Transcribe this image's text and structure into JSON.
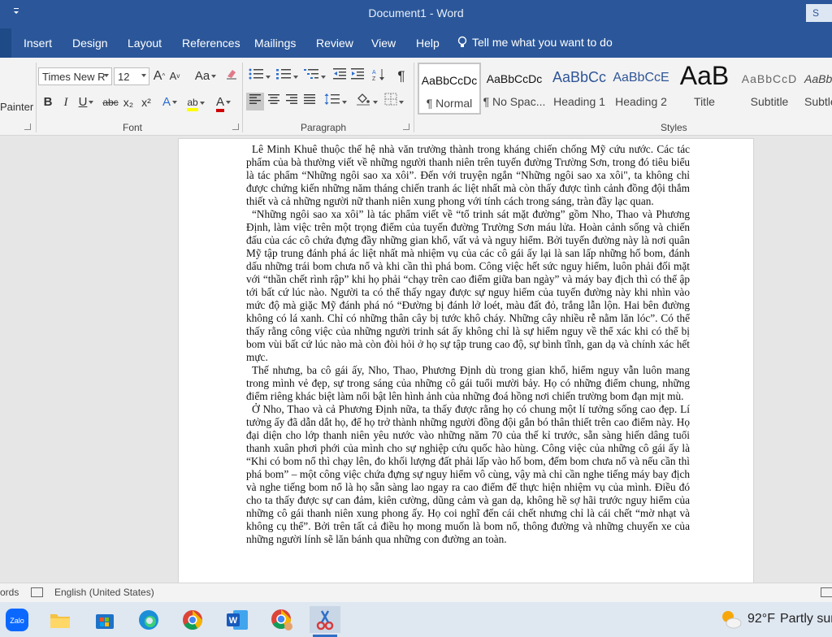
{
  "window": {
    "title": "Document1  -  Word",
    "signin_label": "S"
  },
  "tabs": [
    {
      "label": "Insert"
    },
    {
      "label": "Design"
    },
    {
      "label": "Layout"
    },
    {
      "label": "References"
    },
    {
      "label": "Mailings"
    },
    {
      "label": "Review"
    },
    {
      "label": "View"
    },
    {
      "label": "Help"
    }
  ],
  "tell_me": {
    "label": "Tell me what you want to do",
    "icon": "lightbulb-icon"
  },
  "clipboard": {
    "format_painter_label": "Painter"
  },
  "font": {
    "group_label": "Font",
    "name": "Times New R",
    "size": "12",
    "grow_label": "A",
    "shrink_label": "A",
    "change_case_label": "Aa",
    "bold": "B",
    "italic": "I",
    "underline": "U",
    "strike": "abc",
    "subscript": "x₂",
    "superscript": "x²",
    "effects": "A",
    "highlight": "ab",
    "color": "A",
    "highlight_color": "#ffff00",
    "font_color": "#d00000"
  },
  "paragraph": {
    "group_label": "Paragraph",
    "pilcrow": "¶"
  },
  "styles": {
    "group_label": "Styles",
    "items": [
      {
        "sample": "AaBbCcDc",
        "name": "¶ Normal"
      },
      {
        "sample": "AaBbCcDc",
        "name": "¶ No Spac..."
      },
      {
        "sample": "AaBbCc",
        "name": "Heading 1"
      },
      {
        "sample": "AaBbCcE",
        "name": "Heading 2"
      },
      {
        "sample": "AaB",
        "name": "Title"
      },
      {
        "sample": "AaBbCcD",
        "name": "Subtitle"
      },
      {
        "sample": "AaBb",
        "name": "Subtle"
      }
    ]
  },
  "document": {
    "paragraphs": [
      "Lê Minh Khuê thuộc thế hệ nhà văn trưởng thành trong kháng chiến chống Mỹ cứu nước. Các tác phẩm của bà thường viết về những người thanh niên trên tuyến đường Trường Sơn, trong đó tiêu biểu là tác phẩm “Những ngôi sao xa xôi”. Đến với truyện ngắn “Những ngôi sao xa xôi\", ta không chỉ được chứng kiến những năm tháng chiến tranh ác liệt nhất mà còn thấy được tình cảnh đồng đội thắm thiết và cả những người nữ thanh niên xung phong với tính cách trong sáng, tràn đầy lạc quan.",
      "“Những ngôi sao xa xôi” là tác phẩm viết về “tổ trinh sát mặt đường” gồm Nho, Thao và Phương Định, làm việc trên một trọng điểm của tuyến đường Trường Sơn máu lửa. Hoàn cảnh sống và chiến đấu của các cô chứa đựng đầy những gian khổ, vất vả và nguy hiểm. Bởi tuyến đường này là nơi quân Mỹ tập trung đánh phá ác liệt nhất mà nhiệm vụ của các cô gái ấy lại là san lấp những hố bom, đánh dấu những trái bom chưa nổ và khi cần thì phá bom. Công việc hết sức nguy hiểm, luôn phải đối mặt với “thần chết rình rập” khi họ phải “chạy trên cao điểm giữa ban ngày” và máy bay địch thì có thể ập tới bất cứ lúc nào. Người ta có thể thấy ngay được sự nguy hiểm của tuyến đường này khi nhìn vào mức độ mà giặc Mỹ đánh phá nó “Đường bị đánh lở loét, màu đất đỏ, trắng lẫn lộn. Hai bên đường không có lá xanh. Chỉ có những thân cây bị tước khô cháy. Những cây nhiều rễ nằm lăn lóc”. Có thể thấy rằng công việc của những người trinh sát ấy không chỉ là sự hiểm nguy về thể xác khi có thể bị bom vùi bất cứ lúc nào mà còn đòi hỏi ở họ sự tập trung cao độ, sự bình tĩnh, gan dạ và chính xác hết mực.",
      "Thế nhưng, ba cô gái ấy, Nho, Thao, Phương Định dù trong gian khổ, hiểm nguy vẫn luôn mang trong mình vẻ đẹp, sự trong sáng của những cô gái tuổi mười bảy. Họ có những điểm chung, những điểm riêng khác biệt làm nổi bật lên hình ảnh của những đoá hồng nơi chiến trường bom đạn mịt mù.",
      "Ở Nho, Thao và cả Phương Định nữa, ta thấy được rằng họ có chung một lí tưởng sống cao đẹp. Lí tưởng ấy đã dẫn dắt họ, để họ trở thành những người đồng đội gắn bó thân thiết trên cao điểm này. Họ đại diện cho lớp thanh niên yêu nước vào những năm 70 của thế kỉ trước, sẵn sàng hiến dâng tuổi thanh xuân phơi phới của mình cho sự nghiệp cứu quốc hào hùng. Công việc của những cô gái ấy là “Khi có bom nổ thì chạy lên, đo khối lượng đất phải lấp vào hố bom, đếm bom chưa nổ và nếu cần thì phá bom” – một công việc chứa đựng sự nguy hiểm vô cùng, vậy mà chỉ cần nghe tiếng máy bay địch và nghe tiếng bom nổ là họ sẵn sàng lao ngay ra cao điểm để thực hiện nhiệm vụ của mình. Điều đó cho ta thấy được sự can đảm, kiên cường, dũng cảm và gan dạ, không hề sợ hãi trước nguy hiểm của những cô gái thanh niên xung phong ấy. Họ coi nghĩ đến cái chết nhưng chỉ là cái chết “mờ nhạt và không cụ thể”. Bởi trên tất cả điều họ mong muốn là bom nổ, thông đường và những chuyến xe của những người lính sẽ lăn bánh qua những con đường an toàn."
    ]
  },
  "status": {
    "words_label": "ords",
    "language": "English (United States)"
  },
  "taskbar": {
    "apps": [
      "zalo-app-icon",
      "file-explorer-icon",
      "microsoft-store-icon",
      "edge-icon",
      "chrome-icon",
      "word-icon",
      "chrome-profile-icon",
      "snipping-tool-icon"
    ],
    "zalo_label": "Zalo",
    "word_letter": "W",
    "weather_temp": "92°F",
    "weather_text": "Partly sunny"
  }
}
